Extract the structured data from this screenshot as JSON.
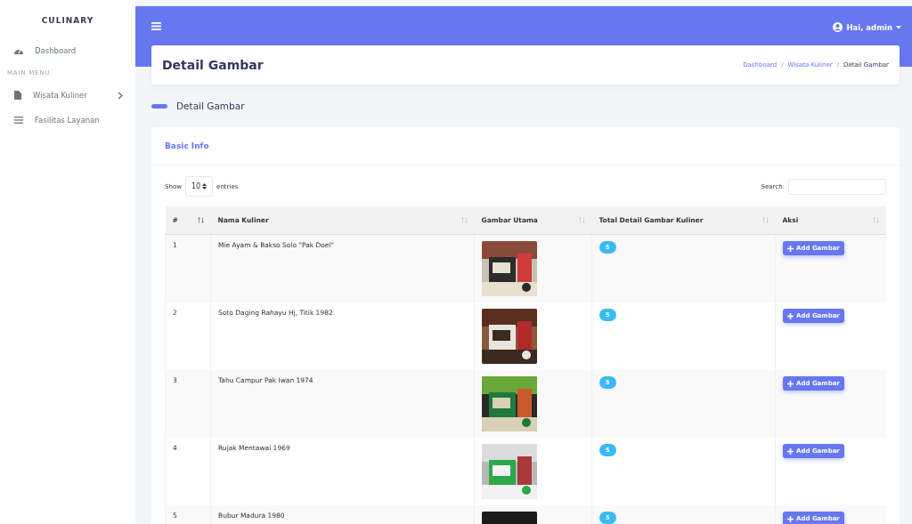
{
  "sidebar": {
    "brand": "CULINARY",
    "items": [
      {
        "kind": "link",
        "label": "Dashboard",
        "expandable": false
      },
      {
        "kind": "heading",
        "label": "MAIN MENU"
      },
      {
        "kind": "link",
        "label": "Wisata Kuliner",
        "expandable": true
      },
      {
        "kind": "link",
        "label": "Fasilitas Layanan",
        "expandable": false
      }
    ]
  },
  "topbar": {
    "user": "Hai, admin"
  },
  "page_header": {
    "title": "Detail Gambar",
    "breadcrumb": [
      {
        "kind": "link",
        "label": "Dashboard"
      },
      {
        "kind": "separator",
        "label": "/"
      },
      {
        "kind": "link",
        "label": "Wisata Kuliner"
      },
      {
        "kind": "separator",
        "label": "/"
      },
      {
        "kind": "current",
        "label": "Detail Gambar"
      }
    ]
  },
  "section_title": "Detail Gambar",
  "card": {
    "title": "Basic Info",
    "show_label": "Show",
    "page_size": "10",
    "entries_label": "entries",
    "search_label": "Search:",
    "table": {
      "columns": [
        {
          "label": "#"
        },
        {
          "label": "Nama Kuliner"
        },
        {
          "label": "Gambar Utama"
        },
        {
          "label": "Total Detail Gambar Kuliner"
        },
        {
          "label": "Aksi"
        }
      ],
      "rows": [
        {
          "no": "1",
          "name": "Mie Ayam & Bakso Solo \"Pak Doel\"",
          "total": "5",
          "action": "Add Gambar"
        },
        {
          "no": "2",
          "name": "Soto Daging Rahayu Hj, Titik 1982",
          "total": "5",
          "action": "Add Gambar"
        },
        {
          "no": "3",
          "name": "Tahu Campur Pak Iwan 1974",
          "total": "5",
          "action": "Add Gambar"
        },
        {
          "no": "4",
          "name": "Rujak Mentawai 1969",
          "total": "5",
          "action": "Add Gambar"
        },
        {
          "no": "5",
          "name": "Bubur Madura 1980",
          "total": "5",
          "action": "Add Gambar"
        }
      ]
    }
  }
}
